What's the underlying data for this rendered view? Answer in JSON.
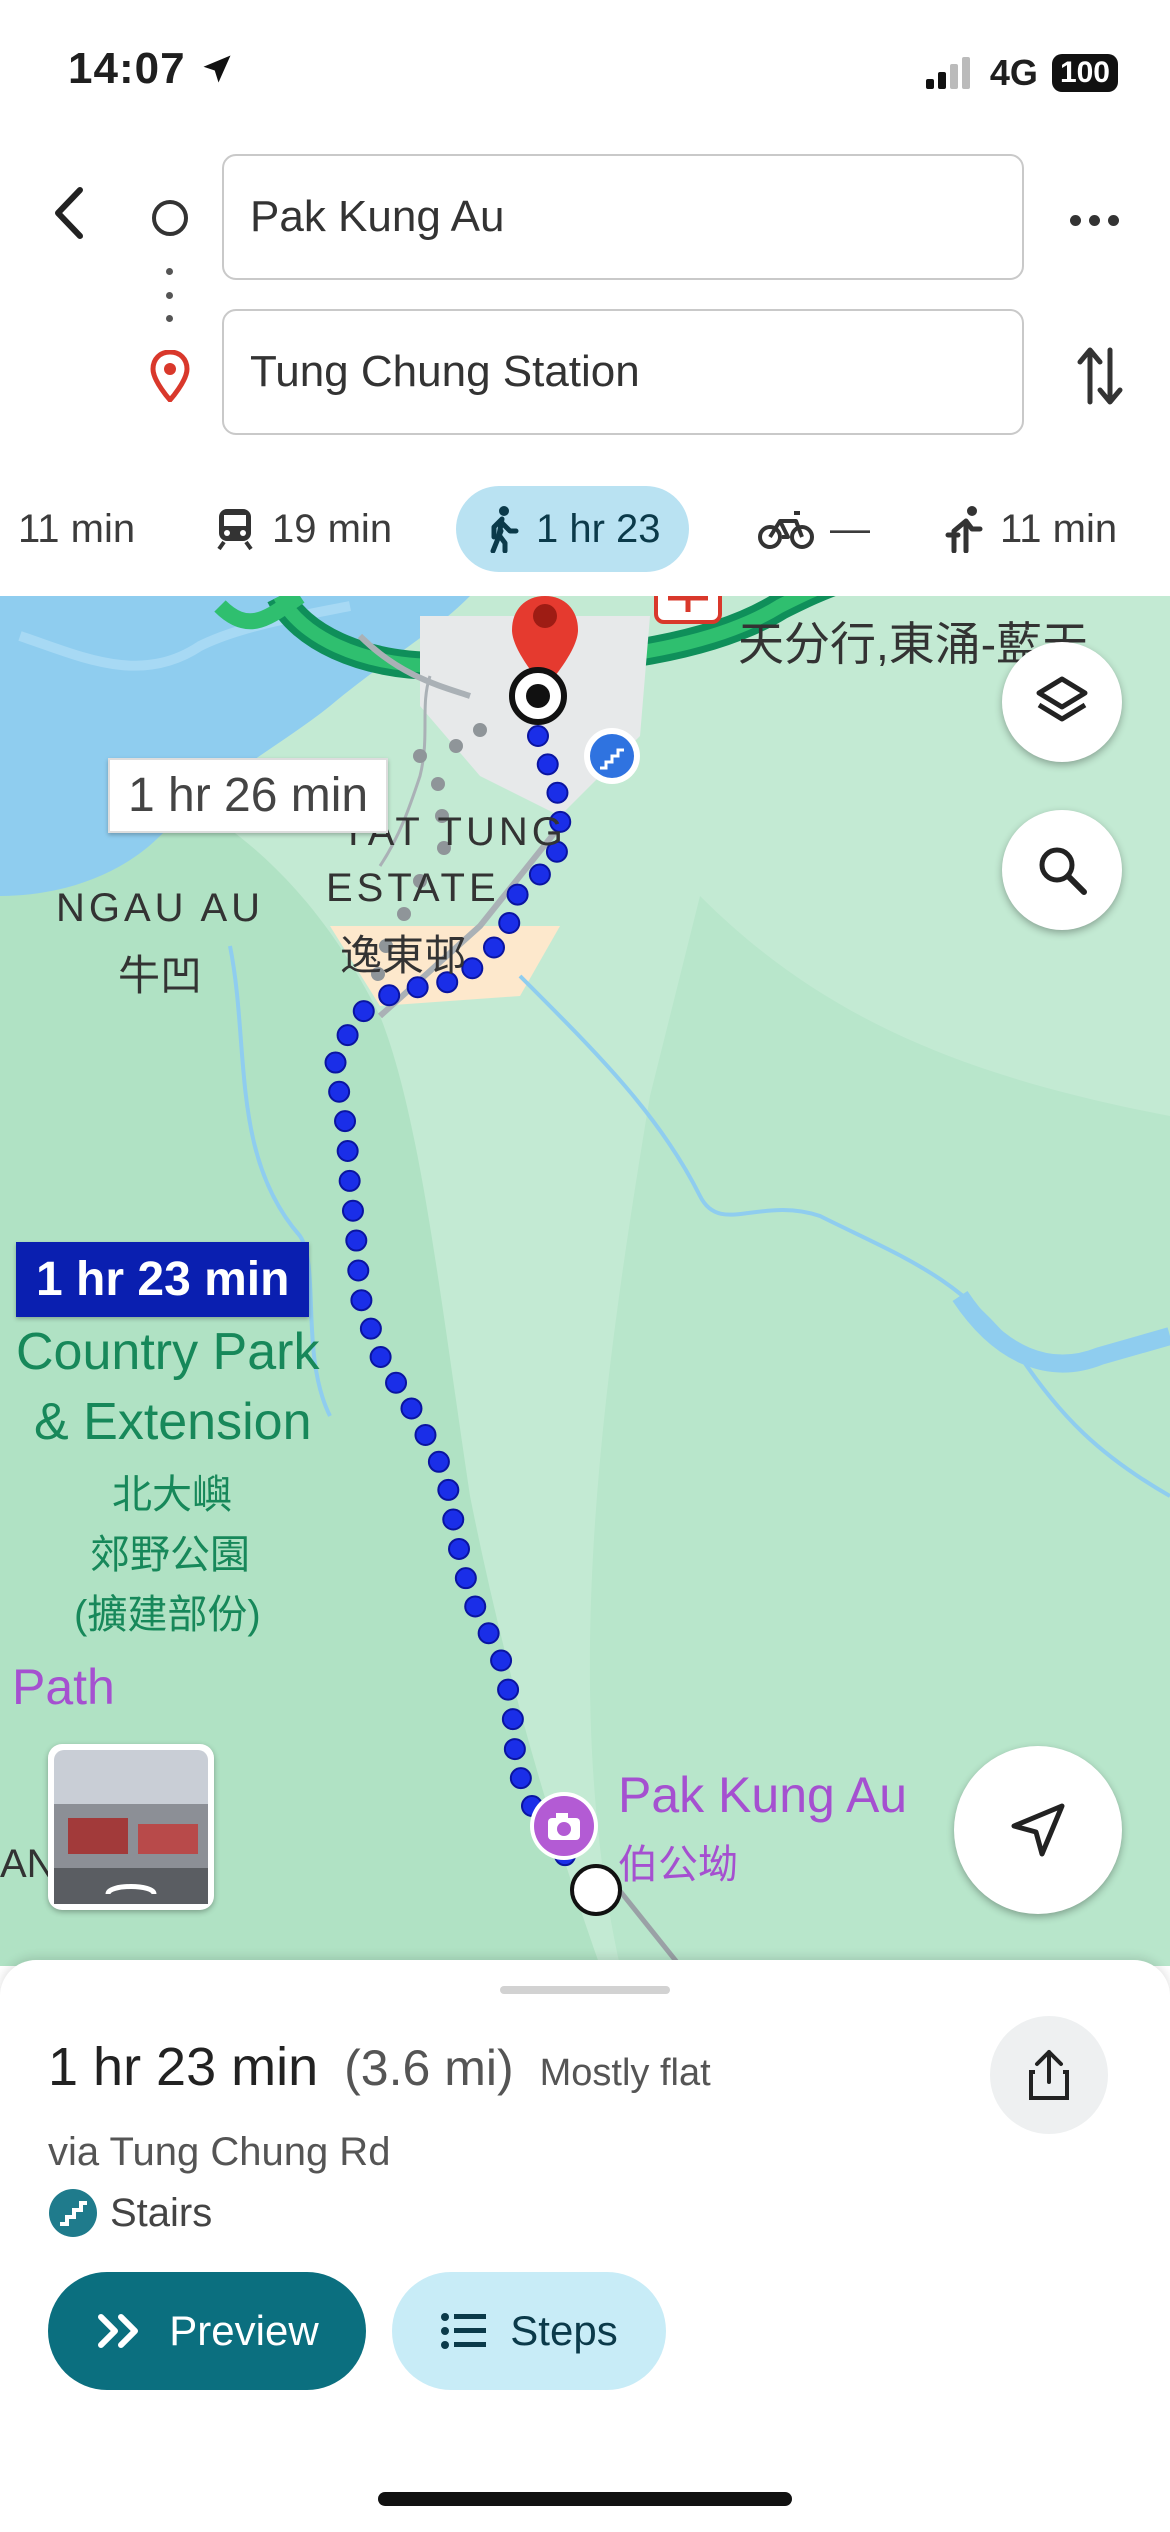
{
  "status": {
    "time": "14:07",
    "network": "4G",
    "battery": "100"
  },
  "directions": {
    "origin": "Pak Kung Au",
    "destination": "Tung Chung Station"
  },
  "modes": [
    {
      "name": "drive",
      "label": "11 min"
    },
    {
      "name": "transit",
      "label": "19 min"
    },
    {
      "name": "walk",
      "label": "1 hr 23",
      "selected": true
    },
    {
      "name": "bike",
      "label": "—"
    },
    {
      "name": "ride",
      "label": "11 min"
    }
  ],
  "map": {
    "labels": {
      "top_chinese": "天分行,東涌-藍天",
      "estate_en_1": "YAT TUNG",
      "estate_en_2": "ESTATE",
      "estate_zh": "逸東邨",
      "ngau_au_en": "NGAU AU",
      "ngau_au_zh": "牛凹",
      "park_en_1": "Country Park",
      "park_en_2": "& Extension",
      "park_zh_1": "北大嶼",
      "park_zh_2": "郊野公園",
      "park_zh_3": "(擴建部份)",
      "path": "Path",
      "edge": "AN",
      "poi_en": "Pak Kung Au",
      "poi_zh": "伯公坳"
    },
    "alt_route_time": "1 hr 26 min",
    "selected_route_time": "1 hr 23 min",
    "route_color": "#1a2ee8"
  },
  "summary": {
    "duration": "1 hr 23 min",
    "distance": "(3.6 mi)",
    "terrain": "Mostly flat",
    "via": "via Tung Chung Rd",
    "warning": "Stairs"
  },
  "actions": {
    "preview": "Preview",
    "steps": "Steps"
  }
}
